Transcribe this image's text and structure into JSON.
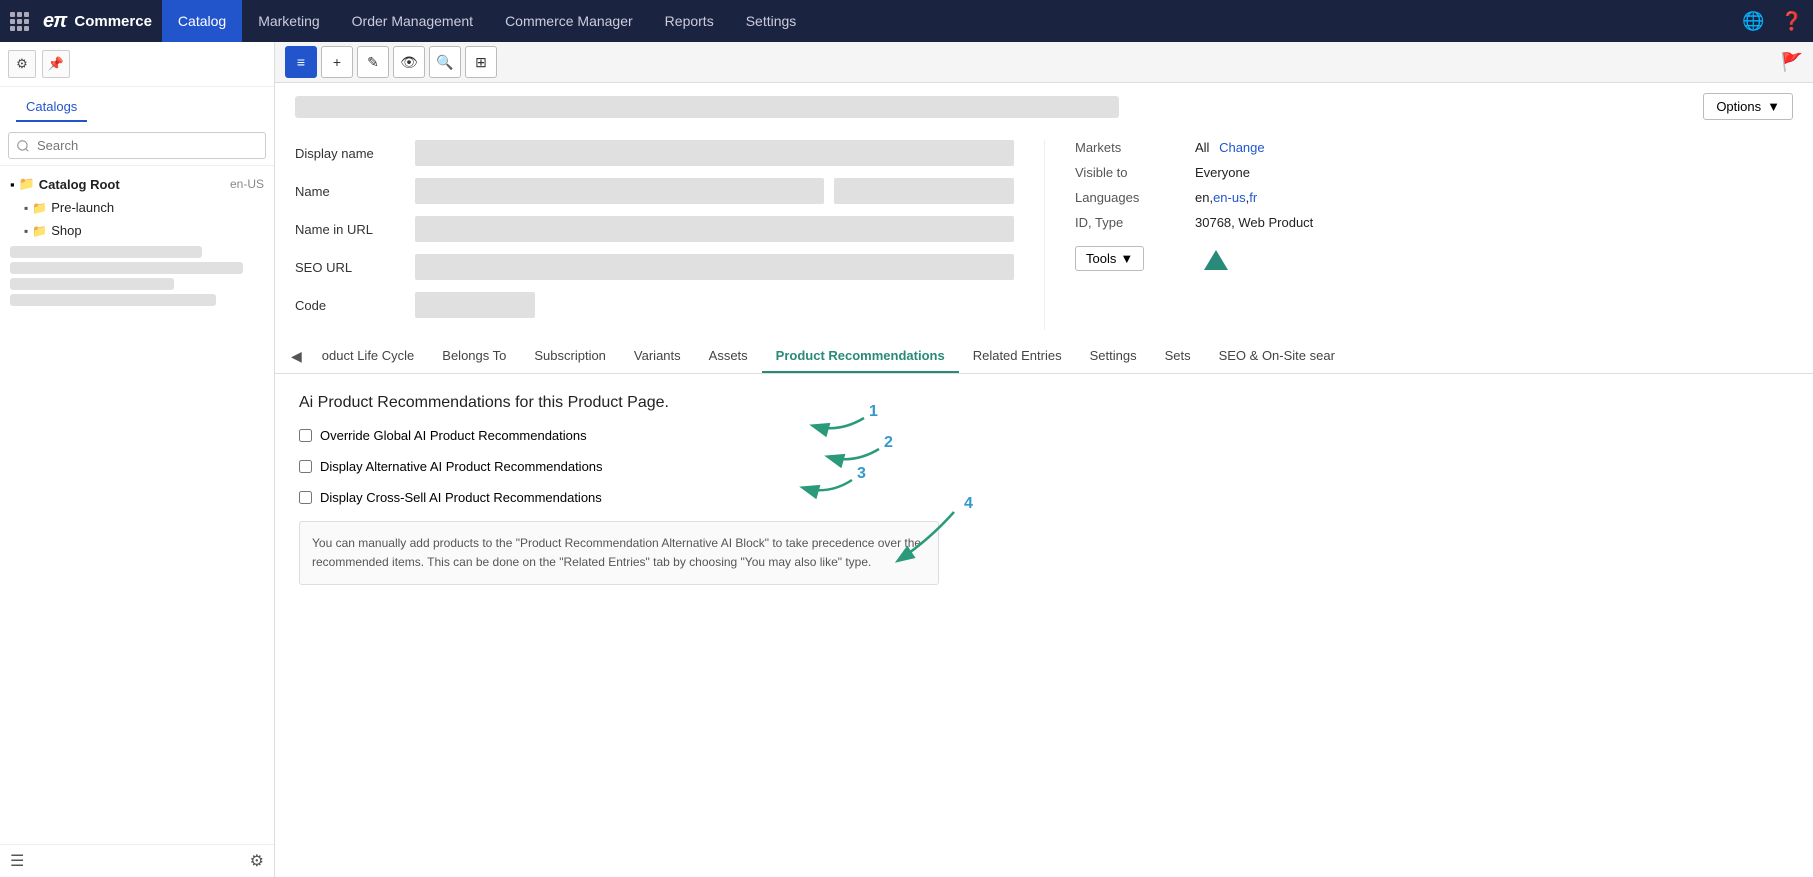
{
  "topnav": {
    "logo": "eπ",
    "brand": "Commerce",
    "items": [
      {
        "label": "Catalog",
        "active": true
      },
      {
        "label": "Marketing",
        "active": false
      },
      {
        "label": "Order Management",
        "active": false
      },
      {
        "label": "Commerce Manager",
        "active": false
      },
      {
        "label": "Reports",
        "active": false
      },
      {
        "label": "Settings",
        "active": false
      }
    ]
  },
  "sidebar": {
    "catalogs_link": "Catalogs",
    "search_placeholder": "Search",
    "tree": {
      "root_label": "Catalog Root",
      "root_lang": "en-US",
      "items": [
        {
          "label": "Pre-launch",
          "indent": 1
        },
        {
          "label": "Shop",
          "indent": 1
        }
      ]
    }
  },
  "toolbar": {
    "options_label": "Options",
    "options_arrow": "▼"
  },
  "form": {
    "fields": [
      {
        "label": "Display name"
      },
      {
        "label": "Name"
      },
      {
        "label": "Name in URL"
      },
      {
        "label": "SEO URL"
      },
      {
        "label": "Code"
      }
    ],
    "sidebar_info": [
      {
        "label": "Markets",
        "value": "All",
        "link": "Change"
      },
      {
        "label": "Visible to",
        "value": "Everyone"
      },
      {
        "label": "Languages",
        "values": [
          "en",
          "en-us",
          "fr"
        ],
        "sep": ","
      },
      {
        "label": "ID, Type",
        "value": "30768, Web Product"
      }
    ],
    "tools_label": "Tools",
    "tools_arrow": "▼"
  },
  "tabs": [
    {
      "label": "oduct Life Cycle"
    },
    {
      "label": "Belongs To"
    },
    {
      "label": "Subscription"
    },
    {
      "label": "Variants"
    },
    {
      "label": "Assets"
    },
    {
      "label": "Product Recommendations",
      "active": true
    },
    {
      "label": "Related Entries"
    },
    {
      "label": "Settings"
    },
    {
      "label": "Sets"
    },
    {
      "label": "SEO & On-Site sear"
    }
  ],
  "panel": {
    "title": "Ai Product Recommendations for this Product Page.",
    "checkboxes": [
      {
        "id": "cb1",
        "label": "Override Global AI Product Recommendations"
      },
      {
        "id": "cb2",
        "label": "Display Alternative AI Product Recommendations"
      },
      {
        "id": "cb3",
        "label": "Display Cross-Sell AI Product Recommendations"
      }
    ],
    "info_text": "You can manually add products to the \"Product Recommendation Alternative AI Block\" to take precedence over the recommended items. This can be done on the \"Related Entries\" tab by choosing \"You may also like\" type.",
    "annotations": [
      {
        "num": "1"
      },
      {
        "num": "2"
      },
      {
        "num": "3"
      },
      {
        "num": "4"
      }
    ]
  }
}
